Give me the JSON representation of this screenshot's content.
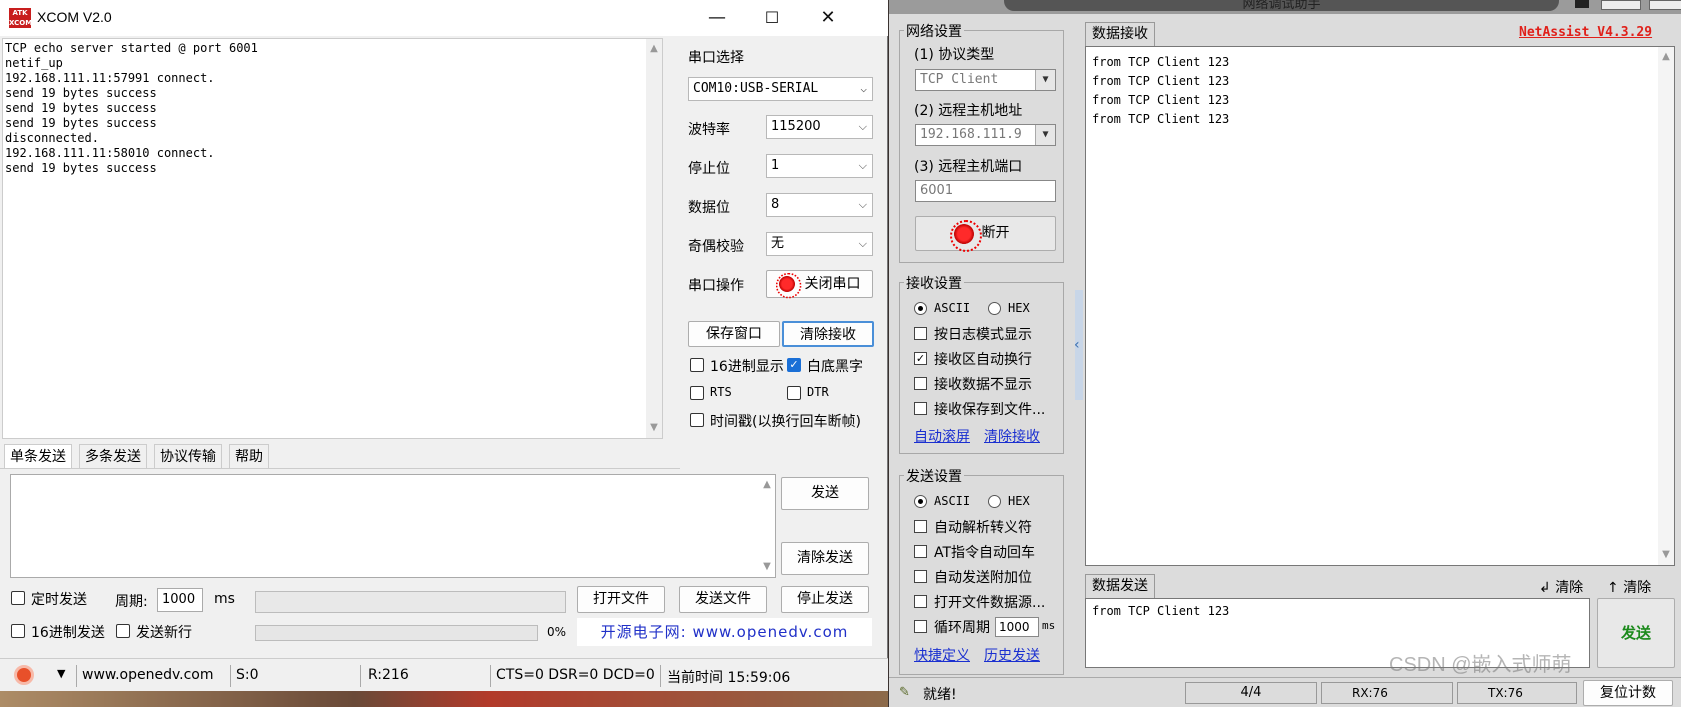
{
  "xcom": {
    "title": "XCOM V2.0",
    "logo": "ATK XCOM",
    "win_min": "—",
    "win_max": "☐",
    "win_close": "✕",
    "receive_text": "TCP echo server started @ port 6001\nnetif_up\n192.168.111.11:57991 connect.\nsend 19 bytes success\nsend 19 bytes success\nsend 19 bytes success\ndisconnected.\n192.168.111.11:58010 connect.\nsend 19 bytes success",
    "serial": {
      "port_label": "串口选择",
      "port_value": "COM10:USB-SERIAL",
      "baud_label": "波特率",
      "baud_value": "115200",
      "stop_label": "停止位",
      "stop_value": "1",
      "data_label": "数据位",
      "data_value": "8",
      "parity_label": "奇偶校验",
      "parity_value": "无",
      "op_label": "串口操作",
      "close_port": "关闭串口",
      "save_window": "保存窗口",
      "clear_recv": "清除接收",
      "hex_display": "16进制显示",
      "white_bg": "白底黑字",
      "rts": "RTS",
      "dtr": "DTR",
      "timestamp": "时间戳(以换行回车断帧)"
    },
    "tabs": [
      "单条发送",
      "多条发送",
      "协议传输",
      "帮助"
    ],
    "send_button": "发送",
    "clear_send": "清除发送",
    "timed_send": "定时发送",
    "period_label": "周期:",
    "period_value": "1000",
    "period_unit": "ms",
    "open_file": "打开文件",
    "send_file": "发送文件",
    "stop_send": "停止发送",
    "hex_send": "16进制发送",
    "send_newline": "发送新行",
    "progress_text": "0%",
    "link_text": "开源电子网: www.openedv.com",
    "status": {
      "url": "www.openedv.com",
      "sent": "S:0",
      "recv": "R:216",
      "lines": "CTS=0 DSR=0 DCD=0",
      "time": "当前时间 15:59:06"
    }
  },
  "net": {
    "title": "网络调试助手",
    "version": "NetAssist V4.3.29",
    "net_settings": "网络设置",
    "protocol_label": "(1) 协议类型",
    "protocol_value": "TCP Client",
    "host_label": "(2) 远程主机地址",
    "host_value": "192.168.111.9",
    "port_label": "(3) 远程主机端口",
    "port_value": "6001",
    "disconnect": "断开",
    "recv_settings": "接收设置",
    "ascii": "ASCII",
    "hex": "HEX",
    "log_mode": "按日志模式显示",
    "auto_wrap": "接收区自动换行",
    "no_show": "接收数据不显示",
    "save_file": "接收保存到文件...",
    "auto_scroll": "自动滚屏",
    "clear_recv": "清除接收",
    "send_settings": "发送设置",
    "auto_escape": "自动解析转义符",
    "at_cr": "AT指令自动回车",
    "add_check": "自动发送附加位",
    "open_src": "打开文件数据源...",
    "loop_label": "循环周期",
    "loop_value": "1000",
    "loop_unit": "ms",
    "shortcut": "快捷定义",
    "history": "历史发送",
    "recv_tab": "数据接收",
    "recv_lines": "from TCP Client 123\nfrom TCP Client 123\nfrom TCP Client 123\nfrom TCP Client 123",
    "send_tab": "数据发送",
    "clear1": "清除",
    "clear2": "清除",
    "send_text": "from TCP Client 123",
    "send_button": "发送",
    "ready": "就绪!",
    "count": "4/4",
    "rx": "RX:76",
    "tx": "TX:76",
    "reset": "复位计数",
    "watermark": "CSDN @嵌入式师萌"
  },
  "colors": {
    "version_red": "#e0201a",
    "send_green": "#1c8a1c",
    "link_blue": "#1a2fd0"
  }
}
